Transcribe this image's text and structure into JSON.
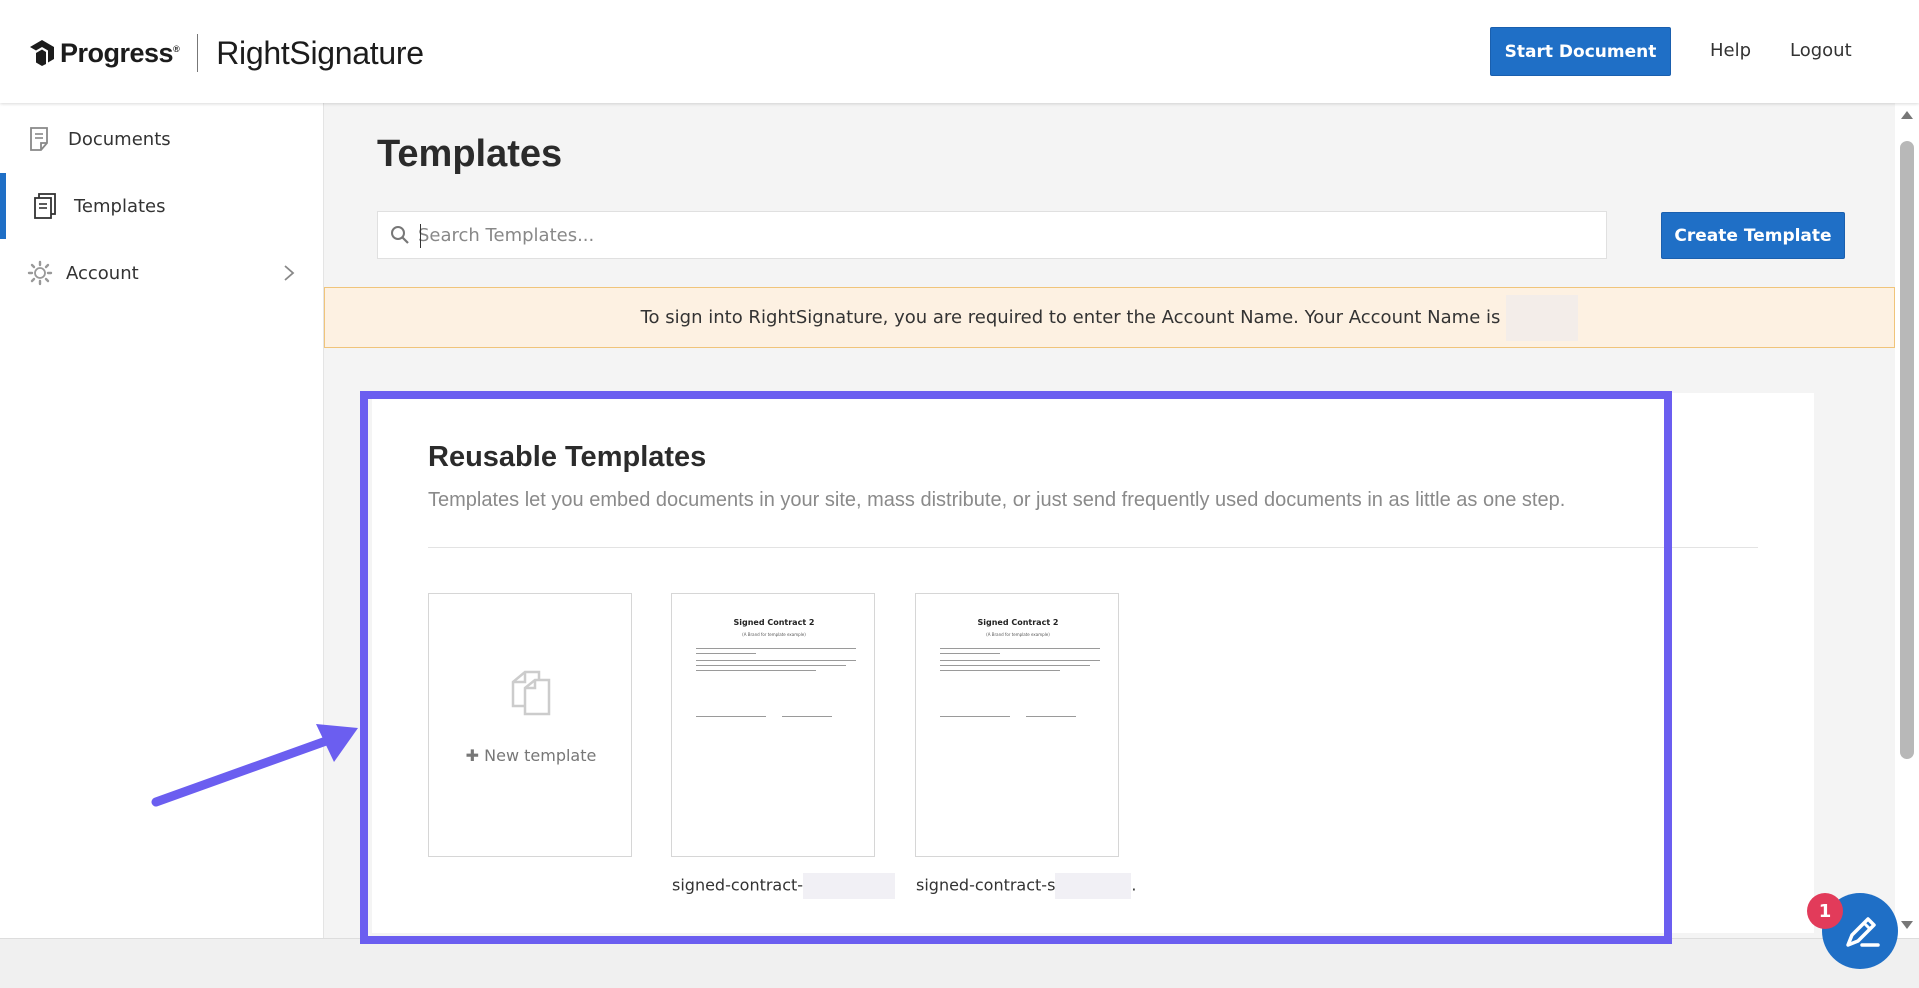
{
  "header": {
    "brand": "Progress",
    "brand_mark": "®",
    "product": "RightSignature",
    "start_document": "Start Document",
    "help": "Help",
    "logout": "Logout"
  },
  "sidebar": {
    "items": [
      {
        "label": "Documents",
        "icon": "document-icon"
      },
      {
        "label": "Templates",
        "icon": "templates-icon",
        "active": true
      },
      {
        "label": "Account",
        "icon": "gear-icon"
      }
    ]
  },
  "main": {
    "title": "Templates",
    "search_placeholder": "Search Templates...",
    "create_template": "Create Template",
    "notice": "To sign into RightSignature, you are required to enter the Account Name. Your Account Name is",
    "panel": {
      "title": "Reusable Templates",
      "description": "Templates let you embed documents in your site, mass distribute, or just send frequently used documents in as little as one step.",
      "new_template": "New template",
      "cards": [
        {
          "thumb_title": "Signed Contract 2",
          "thumb_subtitle": "(A Brand for template example)",
          "name": "signed-contract-",
          "name_suffix": ""
        },
        {
          "thumb_title": "Signed Contract 2",
          "thumb_subtitle": "(A Brand for template example)",
          "name": "signed-contract-s",
          "name_suffix": "."
        }
      ]
    }
  },
  "widget": {
    "badge": "1"
  },
  "colors": {
    "primary": "#1f6fc6",
    "annotation": "#6b5ef0",
    "notice_bg": "#fdf1e2",
    "badge": "#e23b5a"
  }
}
